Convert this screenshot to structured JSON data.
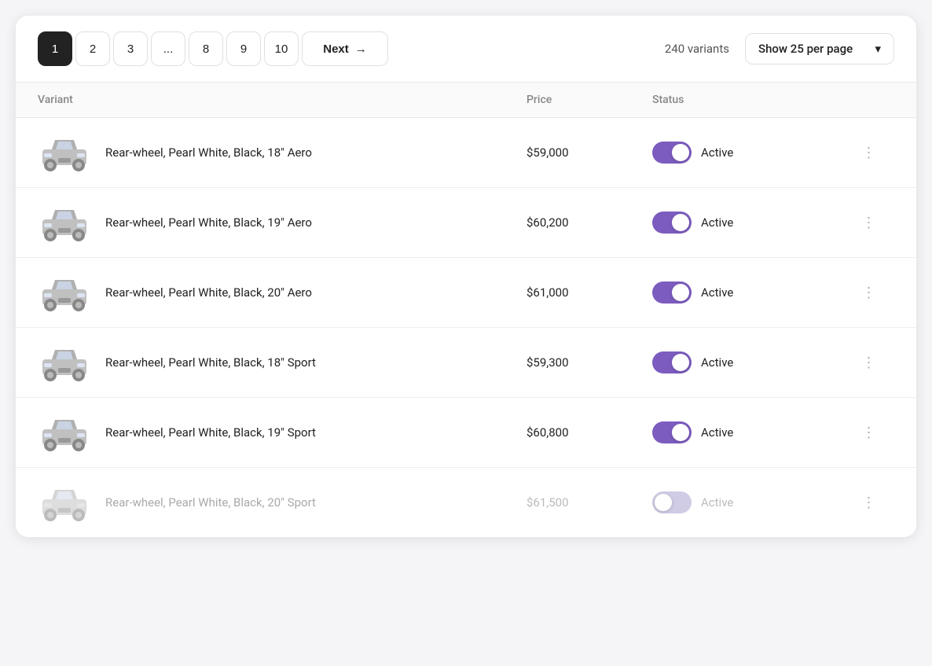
{
  "pagination": {
    "pages": [
      "1",
      "2",
      "3",
      "...",
      "8",
      "9",
      "10"
    ],
    "active_page": "1",
    "next_label": "Next",
    "next_arrow": "→"
  },
  "variants_count": "240 variants",
  "per_page": {
    "label": "Show 25 per page",
    "chevron": "▾"
  },
  "table": {
    "headers": {
      "variant": "Variant",
      "price": "Price",
      "status": "Status"
    },
    "rows": [
      {
        "id": 1,
        "variant": "Rear-wheel, Pearl White, Black, 18\" Aero",
        "price": "$59,000",
        "status": "Active",
        "toggle_on": true,
        "dimmed": false
      },
      {
        "id": 2,
        "variant": "Rear-wheel, Pearl White, Black, 19\" Aero",
        "price": "$60,200",
        "status": "Active",
        "toggle_on": true,
        "dimmed": false
      },
      {
        "id": 3,
        "variant": "Rear-wheel, Pearl White, Black, 20\" Aero",
        "price": "$61,000",
        "status": "Active",
        "toggle_on": true,
        "dimmed": false
      },
      {
        "id": 4,
        "variant": "Rear-wheel, Pearl White, Black, 18\" Sport",
        "price": "$59,300",
        "status": "Active",
        "toggle_on": true,
        "dimmed": false
      },
      {
        "id": 5,
        "variant": "Rear-wheel, Pearl White, Black, 19\" Sport",
        "price": "$60,800",
        "status": "Active",
        "toggle_on": true,
        "dimmed": false
      },
      {
        "id": 6,
        "variant": "Rear-wheel, Pearl White, Black, 20\" Sport",
        "price": "$61,500",
        "status": "Active",
        "toggle_on": false,
        "dimmed": true
      }
    ]
  }
}
